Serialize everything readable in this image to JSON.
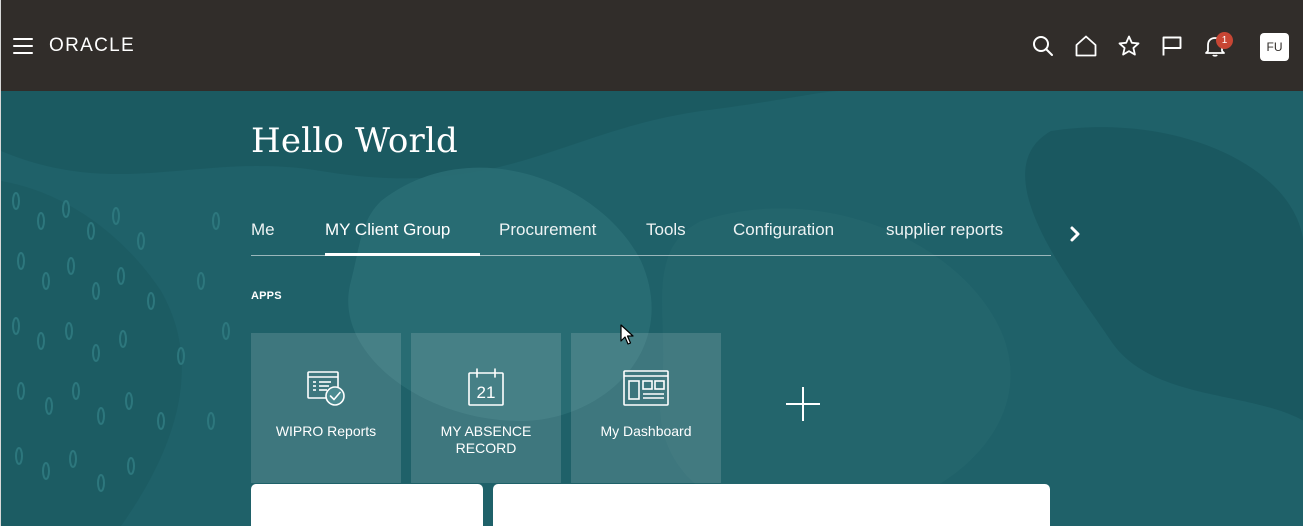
{
  "header": {
    "brand": "ORACLE",
    "icons": [
      "menu-icon",
      "search-icon",
      "home-icon",
      "favorites-icon",
      "flag-icon",
      "notifications-icon"
    ],
    "notification_count": "1",
    "user_initials": "FU",
    "bg_color": "#312d2a"
  },
  "hero": {
    "greeting": "Hello World",
    "bg_color": "#1f6169"
  },
  "tabs": {
    "items": [
      {
        "label": "Me",
        "active": false
      },
      {
        "label": "MY Client Group",
        "active": true
      },
      {
        "label": "Procurement",
        "active": false
      },
      {
        "label": "Tools",
        "active": false
      },
      {
        "label": "Configuration",
        "active": false
      },
      {
        "label": "supplier reports",
        "active": false
      }
    ],
    "next_icon": "chevron-right-icon"
  },
  "apps": {
    "section_label": "APPS",
    "tiles": [
      {
        "label": "WIPRO Reports",
        "icon": "report-check-icon"
      },
      {
        "label": "MY ABSENCE RECORD",
        "icon": "calendar-21-icon",
        "icon_text": "21"
      },
      {
        "label": "My Dashboard",
        "icon": "dashboard-icon"
      }
    ],
    "add_icon": "plus-icon"
  }
}
